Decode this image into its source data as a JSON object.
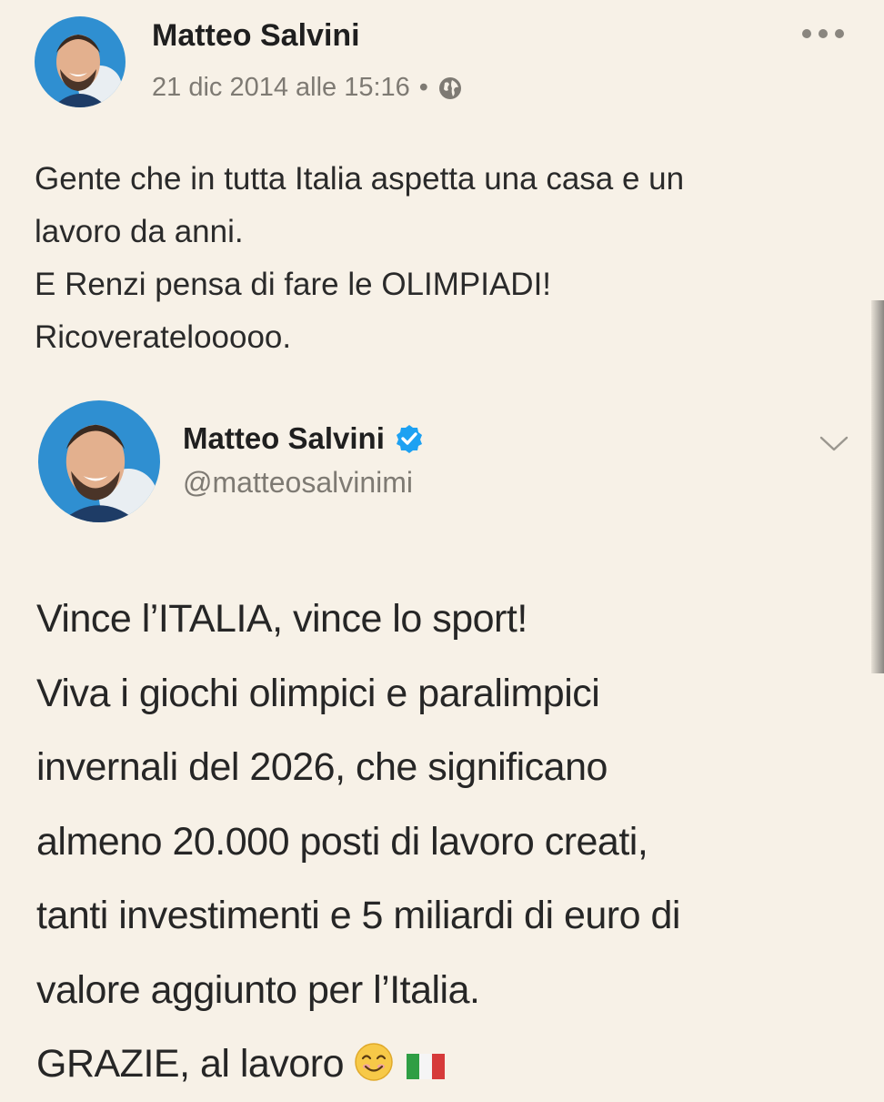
{
  "facebook_post": {
    "author": "Matteo Salvini",
    "timestamp": "21 dic 2014 alle 15:16",
    "separator": "•",
    "privacy_icon": "globe-icon",
    "menu_icon": "more-horizontal-icon",
    "text_lines": [
      "Gente che in tutta Italia aspetta una casa e un",
      "lavoro da anni.",
      "E Renzi pensa di fare le OLIMPIADI!",
      "Ricoveratelooooo."
    ]
  },
  "tweet": {
    "author": "Matteo Salvini",
    "verified_icon": "verified-badge-icon",
    "handle": "@matteosalvinimi",
    "menu_icon": "chevron-down-icon",
    "text_lines": [
      "Vince l’ITALIA, vince lo sport!",
      "Viva i giochi olimpici e paralimpici",
      "invernali del 2026, che significano",
      "almeno 20.000 posti di lavoro creati,",
      "tanti investimenti e 5 miliardi di euro di",
      "valore aggiunto per l’Italia.",
      "GRAZIE, al lavoro"
    ],
    "trailing_emoji": [
      "smiling-face-emoji",
      "italy-flag-emoji"
    ]
  },
  "colors": {
    "background": "#f7f1e7",
    "text": "#2a2a2a",
    "muted": "#7e7a73",
    "verified_blue": "#1da1f2",
    "avatar_blue": "#2f8fd1"
  }
}
